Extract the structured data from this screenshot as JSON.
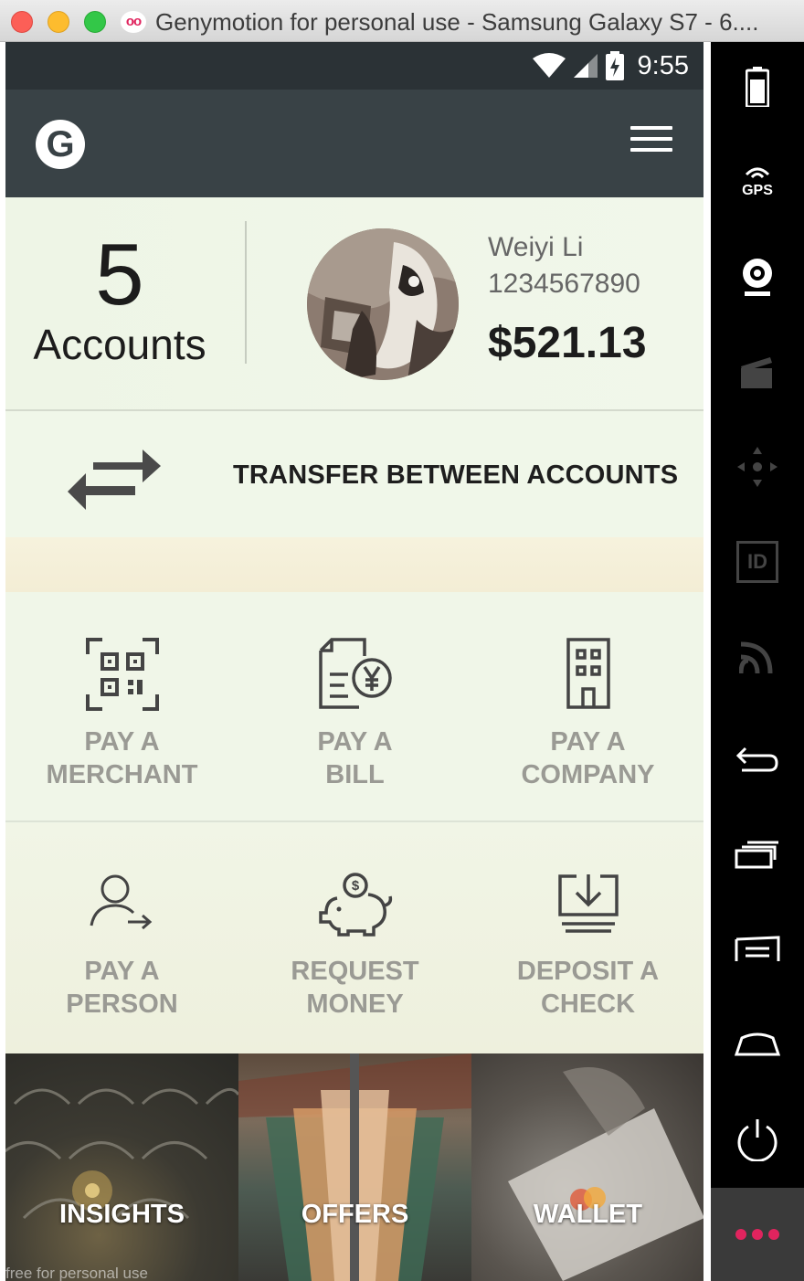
{
  "window": {
    "title": "Genymotion for personal use - Samsung Galaxy S7 - 6....",
    "app_logo_text": "oo"
  },
  "statusbar": {
    "time": "9:55"
  },
  "appbar": {
    "logo_letter": "G",
    "menu_icon": "hamburger-menu-icon"
  },
  "summary": {
    "accounts_count": "5",
    "accounts_label": "Accounts",
    "user_name": "Weiyi Li",
    "user_phone": "1234567890",
    "balance": "$521.13"
  },
  "transfer": {
    "label": "TRANSFER BETWEEN ACCOUNTS",
    "icon": "swap-arrows-icon"
  },
  "actions": [
    {
      "line1": "PAY A",
      "line2": "MERCHANT",
      "icon": "qr-code-icon"
    },
    {
      "line1": "PAY A",
      "line2": "BILL",
      "icon": "bill-yen-icon"
    },
    {
      "line1": "PAY A",
      "line2": "COMPANY",
      "icon": "building-icon"
    },
    {
      "line1": "PAY A",
      "line2": "PERSON",
      "icon": "person-arrow-icon"
    },
    {
      "line1": "REQUEST",
      "line2": "MONEY",
      "icon": "piggy-bank-icon"
    },
    {
      "line1": "DEPOSIT A",
      "line2": "CHECK",
      "icon": "download-tray-icon"
    }
  ],
  "tiles": [
    {
      "label": "INSIGHTS"
    },
    {
      "label": "OFFERS"
    },
    {
      "label": "WALLET"
    }
  ],
  "watermark": "free for personal use",
  "sidepanel": {
    "gps_label": "GPS",
    "id_label": "ID"
  },
  "colors": {
    "appbar": "#394246",
    "statusbar": "#2b3236",
    "action_label": "#9a9a94",
    "more_dots": "#e0245e"
  }
}
